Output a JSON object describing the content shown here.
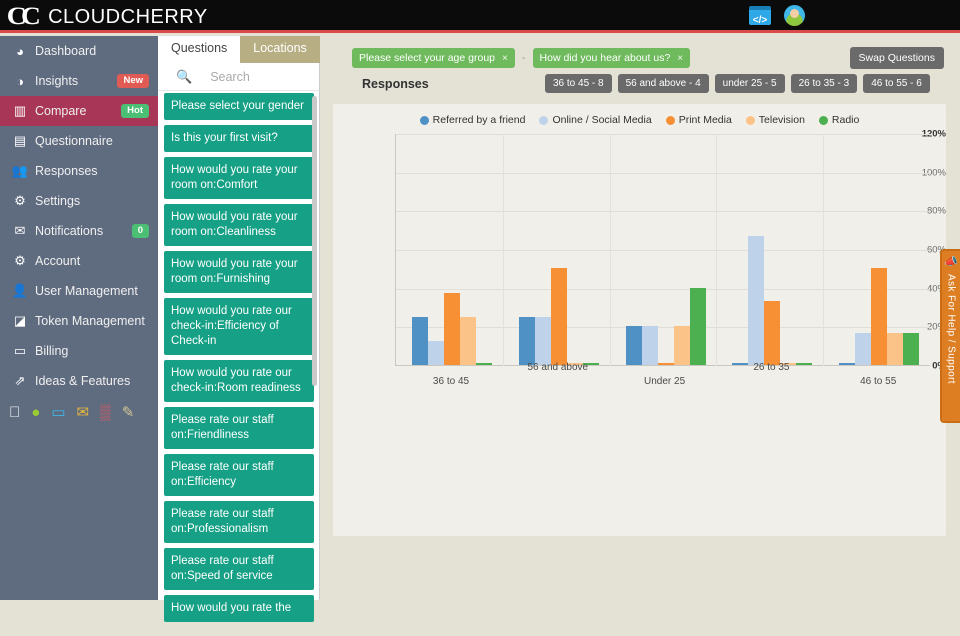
{
  "app": {
    "brand_cc": "CC",
    "brand_name": "CLOUDCHERRY",
    "accent_red": "#d94a4a",
    "sidebar_bg": "#5f6b7f",
    "active_bg": "#a83656"
  },
  "topbar": {
    "code_icon": "code-icon",
    "code_glyph": "</>",
    "avatar": "user-avatar-icon"
  },
  "sidebar": {
    "items": [
      {
        "label": "Dashboard",
        "icon": "dashboard-gauge-icon",
        "glyph": "◔",
        "badge": "",
        "badge_type": "",
        "active": false
      },
      {
        "label": "Insights",
        "icon": "eye-insights-icon",
        "glyph": "◉",
        "badge": "New",
        "badge_type": "new",
        "active": false
      },
      {
        "label": "Compare",
        "icon": "bar-chart-icon",
        "glyph": "ὌA",
        "badge": "Hot",
        "badge_type": "hot",
        "active": true
      },
      {
        "label": "Questionnaire",
        "icon": "questionnaire-icon",
        "glyph": "▤",
        "badge": "",
        "badge_type": "",
        "active": false
      },
      {
        "label": "Responses",
        "icon": "people-icon",
        "glyph": "☻",
        "badge": "",
        "badge_type": "",
        "active": false
      },
      {
        "label": "Settings",
        "icon": "gear-icon",
        "glyph": "⚙",
        "badge": "",
        "badge_type": "",
        "active": false
      },
      {
        "label": "Notifications",
        "icon": "envelope-icon",
        "glyph": "✉",
        "badge": "0",
        "badge_type": "zero",
        "active": false
      },
      {
        "label": "Account",
        "icon": "gears-account-icon",
        "glyph": "⚙",
        "badge": "",
        "badge_type": "",
        "active": false
      },
      {
        "label": "User Management",
        "icon": "users-group-icon",
        "glyph": "☺",
        "badge": "",
        "badge_type": "",
        "active": false
      },
      {
        "label": "Token Management",
        "icon": "tags-icon",
        "glyph": "⧉",
        "badge": "",
        "badge_type": "",
        "active": false
      },
      {
        "label": "Billing",
        "icon": "credit-card-icon",
        "glyph": "▭",
        "badge": "",
        "badge_type": "",
        "active": false
      },
      {
        "label": "Ideas & Features",
        "icon": "external-link-icon",
        "glyph": "↗",
        "badge": "",
        "badge_type": "",
        "active": false
      }
    ],
    "social": [
      {
        "name": "apple-icon",
        "glyph": "",
        "color": "#ffffff"
      },
      {
        "name": "android-icon",
        "glyph": "●",
        "color": "#9acd32"
      },
      {
        "name": "laptop-icon",
        "glyph": "▭",
        "color": "#3fb7e8"
      },
      {
        "name": "email-icon",
        "glyph": "✉",
        "color": "#e8b93f"
      },
      {
        "name": "qr-code-icon",
        "glyph": "▒",
        "color": "#e8575f"
      },
      {
        "name": "edit-icon",
        "glyph": "✎",
        "color": "#d2c79a"
      }
    ]
  },
  "panel": {
    "tabs": [
      {
        "label": "Questions",
        "active": true
      },
      {
        "label": "Locations",
        "active": false
      }
    ],
    "search": {
      "icon": "search-icon",
      "placeholder": "Search",
      "value": ""
    },
    "questions": [
      "Please select your gender",
      "Is this your first visit?",
      "How would you rate your room on:Comfort",
      "How would you rate your room on:Cleanliness",
      "How would you rate your room on:Furnishing",
      "How would you rate our check-in:Efficiency of Check-in",
      "How would you rate our check-in:Room readiness",
      "Please rate our staff on:Friendliness",
      "Please rate our staff on:Efficiency",
      "Please rate our staff on:Professionalism",
      "Please rate our staff on:Speed of service",
      "How would you rate the"
    ]
  },
  "filters": {
    "chips": [
      {
        "label": "Please select your age group",
        "close": "×"
      },
      {
        "label": "How did you hear about us?",
        "close": "×"
      }
    ],
    "separator": "-",
    "swap_label": "Swap Questions"
  },
  "responses": {
    "title": "Responses",
    "pills": [
      "36 to 45 - 8",
      "56 and above - 4",
      "under 25 - 5",
      "26 to 35 - 3",
      "46 to 55 - 6"
    ]
  },
  "help_tab": {
    "icon": "megaphone-icon",
    "glyph": "◂",
    "label": "Ask For Help / Support"
  },
  "chart_data": {
    "type": "bar",
    "title": "Responses",
    "xlabel": "",
    "ylabel": "",
    "ylim": [
      0,
      120
    ],
    "yticks": [
      "0%",
      "20%",
      "40%",
      "60%",
      "80%",
      "100%",
      "120%"
    ],
    "grid": true,
    "legend_position": "top",
    "categories": [
      "36 to 45",
      "56 and above",
      "Under 25",
      "26 to 35",
      "46 to 55"
    ],
    "series": [
      {
        "name": "Referred by a friend",
        "color": "#4f91c5",
        "values": [
          25,
          25,
          20,
          0,
          0
        ]
      },
      {
        "name": "Online / Social Media",
        "color": "#bed3ea",
        "values": [
          12.5,
          25,
          20,
          66.7,
          16.7
        ]
      },
      {
        "name": "Print Media",
        "color": "#f79035",
        "values": [
          37.5,
          50,
          0,
          33.3,
          50
        ]
      },
      {
        "name": "Television",
        "color": "#fcc389",
        "values": [
          25,
          0,
          20,
          0,
          16.7
        ]
      },
      {
        "name": "Radio",
        "color": "#4caf50",
        "values": [
          0,
          0,
          40,
          0,
          16.7
        ]
      }
    ]
  }
}
